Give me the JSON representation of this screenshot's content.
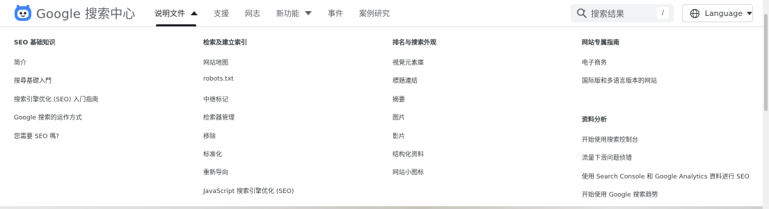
{
  "header": {
    "logo_text": "Google 搜索中心",
    "nav": [
      {
        "label": "说明文件",
        "dropdown": true,
        "active": true,
        "caret": "caret-up"
      },
      {
        "label": "支援",
        "dropdown": false
      },
      {
        "label": "网志",
        "dropdown": false
      },
      {
        "label": "新功能",
        "dropdown": true,
        "caret": "caret-down"
      },
      {
        "label": "事件",
        "dropdown": false
      },
      {
        "label": "案例研究",
        "dropdown": false
      }
    ],
    "search": {
      "placeholder": "搜索结果",
      "shortcut": "/"
    },
    "language": {
      "label": "Language"
    }
  },
  "menu": {
    "columns": [
      {
        "title": "SEO 基础知识",
        "links": [
          "简介",
          "搜尋基礎入門",
          "搜索引擎优化 (SEO) 入门指南",
          "Google 搜索的运作方式",
          "您需要 SEO 嗎?"
        ]
      },
      {
        "title": "检索及建立索引",
        "links": [
          "网站地图",
          "robots.txt",
          "中继标记",
          "检索器管理",
          "移除",
          "标准化",
          "重新导向",
          "JavaScript 搜索引擎优化 (SEO)"
        ]
      },
      {
        "title": "排名与搜索外观",
        "links": [
          "視覺元素庫",
          "標題連結",
          "摘要",
          "图片",
          "影片",
          "结构化资料",
          "网站小图标"
        ]
      },
      {
        "title": "网站专属指南",
        "links": [
          "电子商务",
          "国际版和多语言版本的网站"
        ],
        "title2": "资料分析",
        "links2": [
          "开始使用搜索控制台",
          "流量下滑问题侦错",
          "使用 Search Console 和 Google Analytics 資料进行 SEO",
          "开始使用 Google 搜索趋势"
        ]
      }
    ]
  },
  "colors": {
    "text_primary": "#202124",
    "text_secondary": "#5f6368",
    "search_bg": "#f1f3f4",
    "logo_blue": "#4285f4"
  }
}
